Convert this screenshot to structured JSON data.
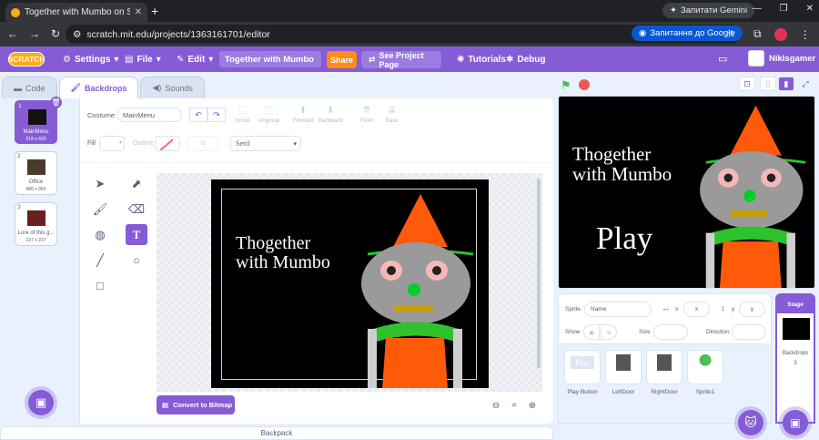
{
  "browser": {
    "tab_title": "Together with Mumbo on Scrat",
    "tab_close": "✕",
    "new_tab": "+",
    "gemini_button": "Запитати Gemini",
    "url": "scratch.mit.edu/projects/1363161701/editor",
    "google_button": "Запитання до Google",
    "window_controls": [
      "—",
      "❐",
      "✕"
    ]
  },
  "menu": {
    "logo": "SCRATCH",
    "settings": "Settings",
    "file": "File",
    "edit": "Edit",
    "project_title": "Together with Mumbo",
    "share": "Share",
    "see_project_page": "See Project Page",
    "tutorials": "Tutorials",
    "debug": "Debug",
    "username": "Niklsgamer"
  },
  "tabs": {
    "code": "Code",
    "backdrops": "Backdrops",
    "sounds": "Sounds"
  },
  "costumes": [
    {
      "num": "1",
      "name": "MainMenu",
      "size": "518 x 433",
      "selected": true
    },
    {
      "num": "2",
      "name": "Office",
      "size": "480 x 360",
      "selected": false
    },
    {
      "num": "3",
      "name": "Lore of this g...",
      "size": "237 x 237",
      "selected": false
    }
  ],
  "paint": {
    "costume_label": "Costume",
    "costume_name": "MainMenu",
    "group": "Group",
    "ungroup": "Ungroup",
    "forward": "Forward",
    "backward": "Backward",
    "front": "Front",
    "back": "Back",
    "fill_label": "Fill",
    "outline_label": "Outline",
    "outline_width": "0",
    "font": "Serif",
    "convert_button": "Convert to Bitmap"
  },
  "artwork": {
    "title": "Thogether\nwith Mumbo",
    "play": "Play"
  },
  "sprite_info": {
    "sprite_label": "Sprite",
    "name_placeholder": "Name",
    "x_label": "x",
    "x_value": "x",
    "y_label": "y",
    "y_value": "y",
    "show_label": "Show",
    "size_label": "Size",
    "direction_label": "Direction"
  },
  "sprites": [
    {
      "name": "Play Button"
    },
    {
      "name": "LeftDoor"
    },
    {
      "name": "RightDoor"
    },
    {
      "name": "Sprite1"
    }
  ],
  "stage_panel": {
    "header": "Stage",
    "backdrops_label": "Backdrops",
    "backdrops_count": "3"
  },
  "backpack": "Backpack",
  "colors": {
    "scratch_purple": "#855cd6",
    "share_orange": "#ff8c1a",
    "hat_orange": "#ff5a0a",
    "robot_gray": "#9a9a9a",
    "nose_green": "#00d02a"
  }
}
